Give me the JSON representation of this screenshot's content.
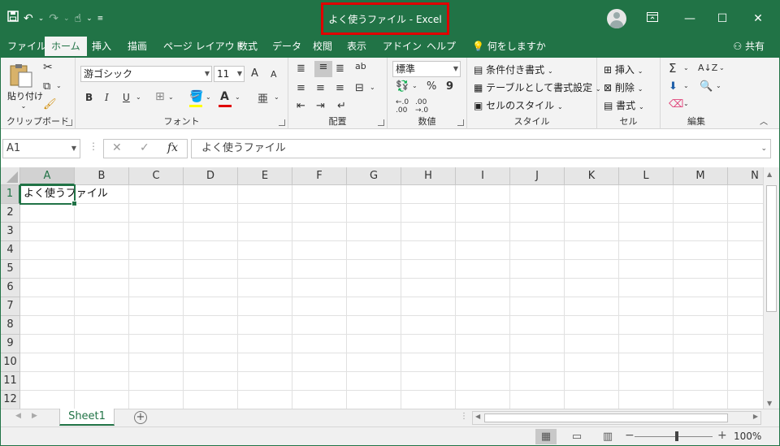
{
  "window": {
    "title": "よく使うファイル  -  Excel",
    "share_label": "共有"
  },
  "colors": {
    "brand": "#217346",
    "highlight_box": "#e00000"
  },
  "qat": {
    "icons": [
      "save-icon",
      "undo-icon",
      "redo-icon",
      "touch-mode-icon",
      "customize-icon"
    ]
  },
  "tabs": [
    "ファイル",
    "ホーム",
    "挿入",
    "描画",
    "ページ レイアウト",
    "数式",
    "データ",
    "校閲",
    "表示",
    "アドイン",
    "ヘルプ",
    "何をしますか"
  ],
  "ribbon": {
    "clipboard": {
      "paste_label": "貼り付け",
      "group_label": "クリップボード"
    },
    "font": {
      "font_name": "游ゴシック",
      "font_size": "11",
      "group_label": "フォント",
      "bold": "B",
      "italic": "I",
      "underline": "U",
      "grow": "A",
      "shrink": "A"
    },
    "alignment": {
      "group_label": "配置"
    },
    "number": {
      "format": "標準",
      "group_label": "数値",
      "percent": "%",
      "comma": "9"
    },
    "styles": {
      "conditional": "条件付き書式",
      "table": "テーブルとして書式設定",
      "cell_styles": "セルのスタイル",
      "group_label": "スタイル"
    },
    "cells": {
      "insert": "挿入",
      "delete": "削除",
      "format": "書式",
      "group_label": "セル"
    },
    "editing": {
      "group_label": "編集"
    }
  },
  "formula_bar": {
    "name_box": "A1",
    "fx": "fx",
    "content": "よく使うファイル"
  },
  "grid": {
    "columns": [
      "A",
      "B",
      "C",
      "D",
      "E",
      "F",
      "G",
      "H",
      "I",
      "J",
      "K",
      "L",
      "M",
      "N"
    ],
    "rows": [
      "1",
      "2",
      "3",
      "4",
      "5",
      "6",
      "7",
      "8",
      "9",
      "10",
      "11",
      "12"
    ],
    "cell_a1": "よく使うファイル"
  },
  "sheets": {
    "tab": "Sheet1",
    "add": "+"
  },
  "status": {
    "zoom": "100%",
    "zoom_minus": "−",
    "zoom_plus": "+"
  }
}
